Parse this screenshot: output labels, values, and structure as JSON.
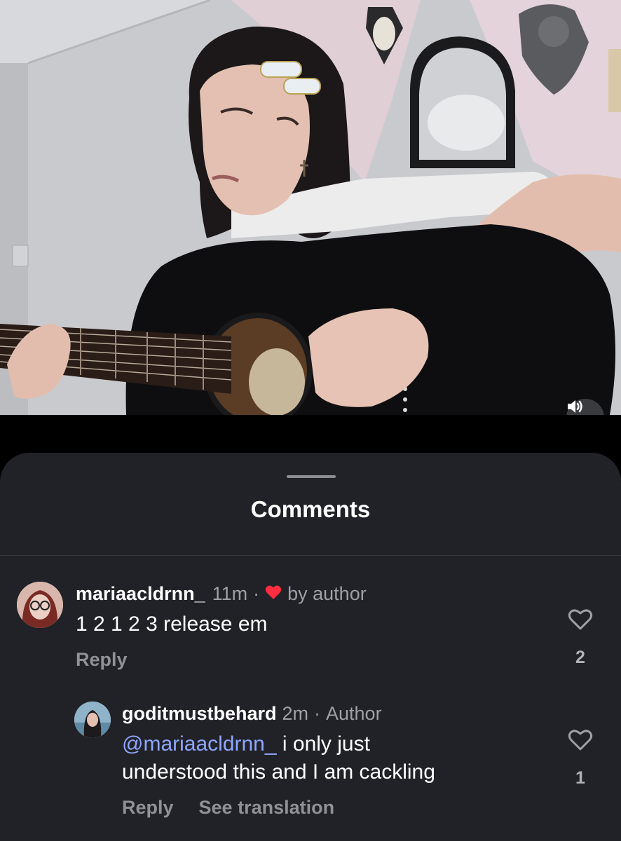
{
  "video": {
    "sound_icon": "speaker-on-icon"
  },
  "comments_sheet": {
    "title": "Comments"
  },
  "comments": [
    {
      "username": "mariaacldrnn_",
      "time": "11m",
      "separator": "·",
      "liked_by_author_icon": "red-heart-icon",
      "liked_by_author_label": "by author",
      "text": "1 2 1 2 3 release em",
      "reply_label": "Reply",
      "like_icon": "heart-outline-icon",
      "like_count": "2"
    },
    {
      "username": "goditmustbehard",
      "time": "2m",
      "separator": "·",
      "author_badge": "Author",
      "mention": "@mariaacldrnn_",
      "text_line1": " i only just",
      "text_line2": "understood this and I am cackling",
      "reply_label": "Reply",
      "translation_label": "See translation",
      "like_icon": "heart-outline-icon",
      "like_count": "1"
    }
  ],
  "colors": {
    "sheet_background": "#212227",
    "heart_red": "#ff2d3f",
    "mention_blue": "#8ea6ff",
    "secondary_text": "#9ea0a6"
  }
}
